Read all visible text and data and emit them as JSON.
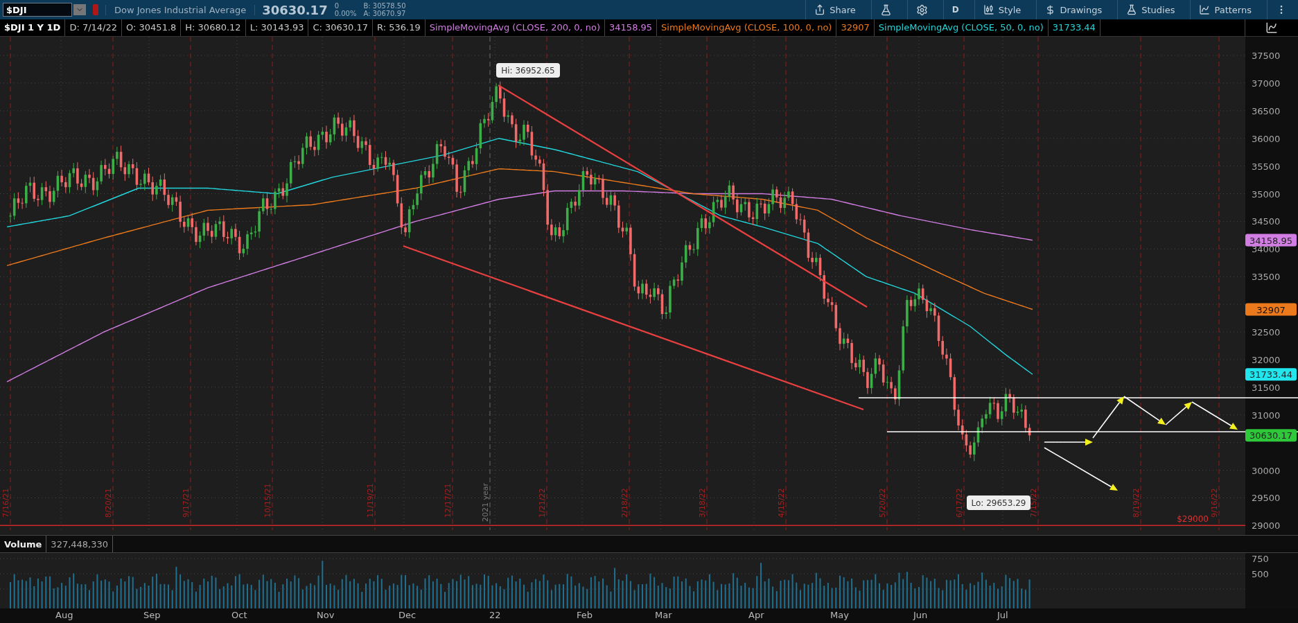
{
  "toolbar": {
    "symbol": "$DJI",
    "name": "Dow Jones Industrial Average",
    "last": "30630.17",
    "change": "0",
    "change_pct": "0.00%",
    "bid": "B: 30578.50",
    "ask": "A: 30670.97",
    "buttons": [
      {
        "kind": "share",
        "label": "Share"
      },
      {
        "kind": "flask"
      },
      {
        "kind": "gear"
      },
      {
        "kind": "text",
        "label": "D"
      },
      {
        "kind": "style",
        "label": "Style"
      },
      {
        "kind": "drawings",
        "label": "Drawings"
      },
      {
        "kind": "studies",
        "label": "Studies"
      },
      {
        "kind": "patterns",
        "label": "Patterns"
      },
      {
        "kind": "more"
      }
    ]
  },
  "legend": {
    "title": "$DJI 1 Y 1D",
    "fields": [
      "D: 7/14/22",
      "O: 30451.8",
      "H: 30680.12",
      "L: 30143.93",
      "C: 30630.17",
      "R: 536.19"
    ],
    "studies": [
      {
        "name": "SimpleMovingAvg (CLOSE, 200, 0, no)",
        "value": "34158.95",
        "color": "#d27de4"
      },
      {
        "name": "SimpleMovingAvg (CLOSE, 100, 0, no)",
        "value": "32907",
        "color": "#ec7a1c"
      },
      {
        "name": "SimpleMovingAvg (CLOSE, 50, 0, no)",
        "value": "31733.44",
        "color": "#22d6dc"
      }
    ]
  },
  "price_chart": {
    "y_labels": [
      "37500",
      "37000",
      "36500",
      "36000",
      "35500",
      "35000",
      "34500",
      "34000",
      "33500",
      "32500",
      "32000",
      "31500",
      "31000",
      "30000",
      "29500",
      "29000"
    ],
    "date_markers": [
      {
        "label": "7/16/21",
        "kind": "event"
      },
      {
        "label": "8/20/21",
        "kind": "event"
      },
      {
        "label": "9/17/21",
        "kind": "event"
      },
      {
        "label": "10/15/21",
        "kind": "event"
      },
      {
        "label": "11/19/21",
        "kind": "event"
      },
      {
        "label": "12/17/21",
        "kind": "event"
      },
      {
        "label": "2021 year",
        "kind": "year"
      },
      {
        "label": "1/21/22",
        "kind": "event"
      },
      {
        "label": "2/18/22",
        "kind": "event"
      },
      {
        "label": "3/18/22",
        "kind": "event"
      },
      {
        "label": "4/15/22",
        "kind": "event"
      },
      {
        "label": "5/20/22",
        "kind": "event"
      },
      {
        "label": "6/17/22",
        "kind": "event"
      },
      {
        "label": "7/15/22",
        "kind": "event"
      },
      {
        "label": "8/19/22",
        "kind": "event"
      },
      {
        "label": "9/16/22",
        "kind": "event"
      }
    ],
    "hi_label": "Hi: 36952.65",
    "lo_label": "Lo: 29653.29",
    "price_badges": [
      {
        "label": "34158.95",
        "color": "#d27de4"
      },
      {
        "label": "32907",
        "color": "#ec7a1c"
      },
      {
        "label": "31733.44",
        "color": "#22e6ee"
      },
      {
        "label": "30630.17",
        "color": "#2ec83a"
      }
    ],
    "alert_label": "$29000"
  },
  "volume": {
    "title": "Volume",
    "value": "327,448,330",
    "y_labels": [
      "750",
      "500"
    ]
  },
  "months": [
    "Aug",
    "Sep",
    "Oct",
    "Nov",
    "Dec",
    "22",
    "Feb",
    "Mar",
    "Apr",
    "May",
    "Jun",
    "Jul"
  ]
}
